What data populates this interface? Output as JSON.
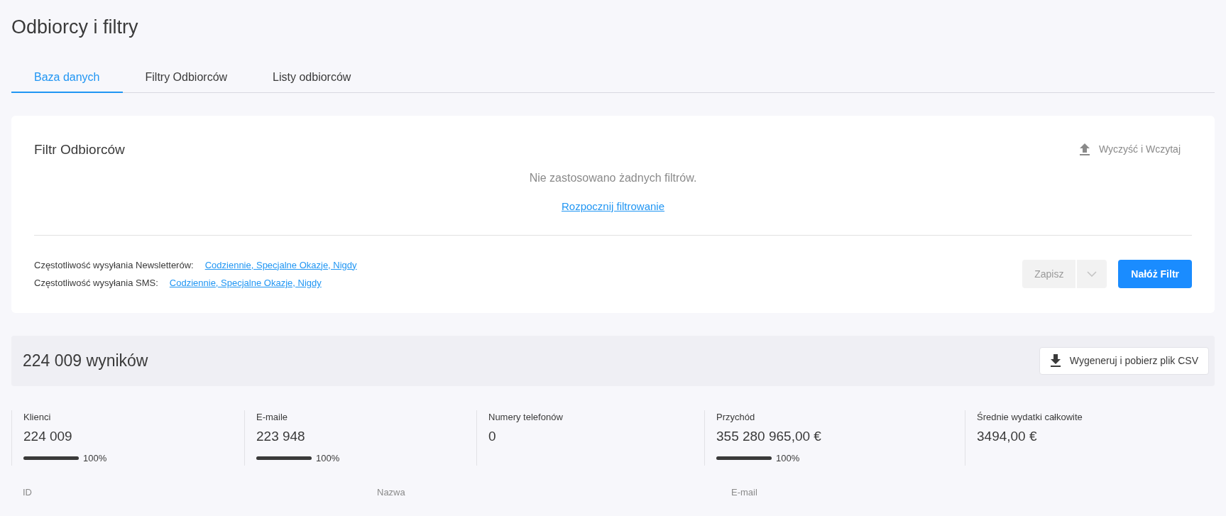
{
  "page_title": "Odbiorcy i filtry",
  "tabs": [
    {
      "label": "Baza danych",
      "selected": true
    },
    {
      "label": "Filtry Odbiorców",
      "selected": false
    },
    {
      "label": "Listy odbiorców",
      "selected": false
    }
  ],
  "filter_card": {
    "title": "Filtr Odbiorców",
    "clear_button": "Wyczyść i Wczytaj",
    "empty_message": "Nie zastosowano żadnych filtrów.",
    "start_link": "Rozpocznij filtrowanie",
    "conditions": [
      {
        "label": "Częstotliwość wysyłania Newsletterów:",
        "value": "Codziennie, Specjalne Okazje, Nigdy"
      },
      {
        "label": "Częstotliwość wysyłania SMS:",
        "value": "Codziennie, Specjalne Okazje, Nigdy"
      }
    ],
    "save_button": {
      "label": "Zapisz",
      "disabled": true
    },
    "apply_button": "Nałóż Filtr"
  },
  "results": {
    "count": "224 009 wyników",
    "csv_button": "Wygeneruj i pobierz plik CSV"
  },
  "stats": [
    {
      "label": "Klienci",
      "value": "224 009",
      "level": 1,
      "percent": "100%"
    },
    {
      "label": "E-maile",
      "value": "223 948",
      "level": 1,
      "percent": "100%"
    },
    {
      "label": "Numery telefonów",
      "value": "0"
    },
    {
      "label": "Przychód",
      "value": "355 280 965,00 €",
      "level": 1,
      "percent": "100%"
    },
    {
      "label": "Średnie wydatki całkowite",
      "value": "3494,00 €"
    }
  ],
  "table": {
    "columns": [
      "ID",
      "Nazwa",
      "E-mail"
    ]
  }
}
